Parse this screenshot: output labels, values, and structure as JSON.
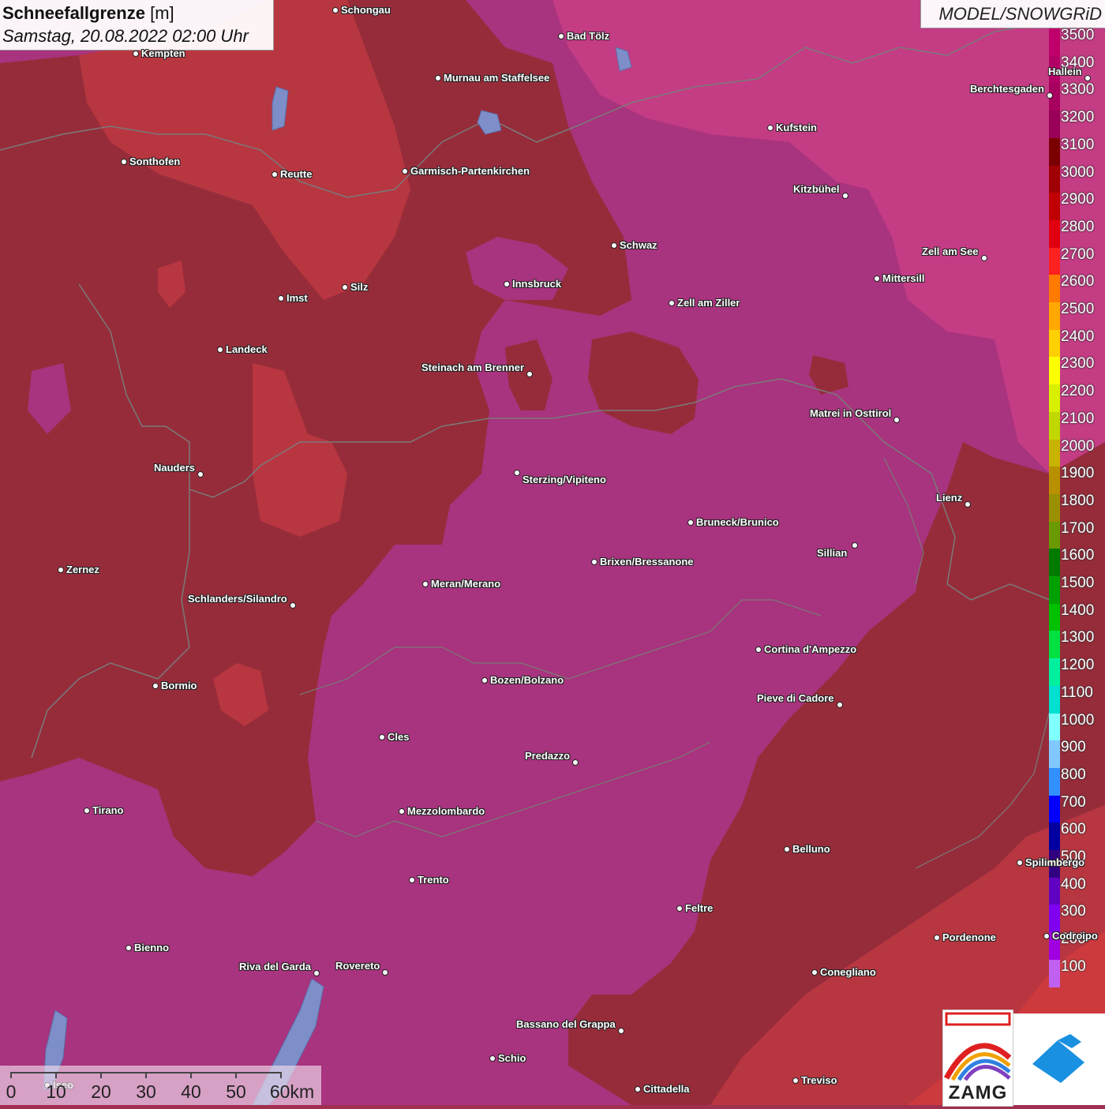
{
  "header": {
    "title_bold": "Schneefallgrenze",
    "title_unit": "[m]",
    "datetime": "Samstag, 20.08.2022 02:00 Uhr",
    "model": "MODEL/SNOWGRiD"
  },
  "legend": {
    "levels": [
      {
        "label": "3500",
        "color": "#c0006a"
      },
      {
        "label": "3400",
        "color": "#b30066"
      },
      {
        "label": "3300",
        "color": "#a8005e"
      },
      {
        "label": "3200",
        "color": "#990058"
      },
      {
        "label": "3100",
        "color": "#7a0000"
      },
      {
        "label": "3000",
        "color": "#a00000"
      },
      {
        "label": "2900",
        "color": "#c00000"
      },
      {
        "label": "2800",
        "color": "#e00010"
      },
      {
        "label": "2700",
        "color": "#ff2020"
      },
      {
        "label": "2600",
        "color": "#ff7a00"
      },
      {
        "label": "2500",
        "color": "#ffa800"
      },
      {
        "label": "2400",
        "color": "#ffd000"
      },
      {
        "label": "2300",
        "color": "#ffff00"
      },
      {
        "label": "2200",
        "color": "#d8f000"
      },
      {
        "label": "2100",
        "color": "#c0d800"
      },
      {
        "label": "2000",
        "color": "#c8b400"
      },
      {
        "label": "1900",
        "color": "#b89000"
      },
      {
        "label": "1800",
        "color": "#9a9000"
      },
      {
        "label": "1700",
        "color": "#6a9a00"
      },
      {
        "label": "1600",
        "color": "#007a00"
      },
      {
        "label": "1500",
        "color": "#00a000"
      },
      {
        "label": "1400",
        "color": "#00c000"
      },
      {
        "label": "1300",
        "color": "#00e040"
      },
      {
        "label": "1200",
        "color": "#00f0a0"
      },
      {
        "label": "1100",
        "color": "#00e0d0"
      },
      {
        "label": "1000",
        "color": "#80ffff"
      },
      {
        "label": "900",
        "color": "#80c8ff"
      },
      {
        "label": "800",
        "color": "#3090ff"
      },
      {
        "label": "700",
        "color": "#0000ff"
      },
      {
        "label": "600",
        "color": "#0000a0"
      },
      {
        "label": "500",
        "color": "#300080"
      },
      {
        "label": "400",
        "color": "#6000c0"
      },
      {
        "label": "300",
        "color": "#8000f0"
      },
      {
        "label": "200",
        "color": "#a000e0"
      },
      {
        "label": "100",
        "color": "#c060f0"
      }
    ]
  },
  "cities": [
    {
      "name": "Schongau"
    },
    {
      "name": "Bad Tölz"
    },
    {
      "name": "Kempten"
    },
    {
      "name": "Murnau am Staffelsee"
    },
    {
      "name": "Hallein"
    },
    {
      "name": "Berchtesgaden"
    },
    {
      "name": "Kufstein"
    },
    {
      "name": "Sonthofen"
    },
    {
      "name": "Reutte"
    },
    {
      "name": "Garmisch-Partenkirchen"
    },
    {
      "name": "Kitzbühel"
    },
    {
      "name": "Schwaz"
    },
    {
      "name": "Zell am See"
    },
    {
      "name": "Innsbruck"
    },
    {
      "name": "Mittersill"
    },
    {
      "name": "Imst"
    },
    {
      "name": "Silz"
    },
    {
      "name": "Zell am Ziller"
    },
    {
      "name": "Landeck"
    },
    {
      "name": "Steinach am Brenner"
    },
    {
      "name": "Matrei in Osttirol"
    },
    {
      "name": "Nauders"
    },
    {
      "name": "Sterzing/Vipiteno"
    },
    {
      "name": "Lienz"
    },
    {
      "name": "Bruneck/Brunico"
    },
    {
      "name": "Sillian"
    },
    {
      "name": "Brixen/Bressanone"
    },
    {
      "name": "Zernez"
    },
    {
      "name": "Meran/Merano"
    },
    {
      "name": "Schlanders/Silandro"
    },
    {
      "name": "Cortina d'Ampezzo"
    },
    {
      "name": "Bozen/Bolzano"
    },
    {
      "name": "Bormio"
    },
    {
      "name": "Pieve di Cadore"
    },
    {
      "name": "Cles"
    },
    {
      "name": "Predazzo"
    },
    {
      "name": "Tirano"
    },
    {
      "name": "Mezzolombardo"
    },
    {
      "name": "Belluno"
    },
    {
      "name": "Spilimbergo"
    },
    {
      "name": "Trento"
    },
    {
      "name": "Feltre"
    },
    {
      "name": "Pordenone"
    },
    {
      "name": "Codroipo"
    },
    {
      "name": "Bienno"
    },
    {
      "name": "Riva del Garda"
    },
    {
      "name": "Rovereto"
    },
    {
      "name": "Conegliano"
    },
    {
      "name": "Bassano del Grappa"
    },
    {
      "name": "Schio"
    },
    {
      "name": "Treviso"
    },
    {
      "name": "Cittadella"
    },
    {
      "name": "Iseo"
    }
  ],
  "scale": {
    "labels": [
      "0",
      "10",
      "20",
      "30",
      "40",
      "50",
      "60km"
    ]
  },
  "logo": {
    "text": "ZAMG"
  },
  "colors": {
    "magenta_zone": "#a8337e",
    "darkred_zone": "#962c3a",
    "red_zone": "#b83640",
    "bright_red_zone": "#cd3a3e",
    "pink_zone": "#c43c84",
    "water": "#7d8ec8",
    "border": "#7a7a7a"
  }
}
